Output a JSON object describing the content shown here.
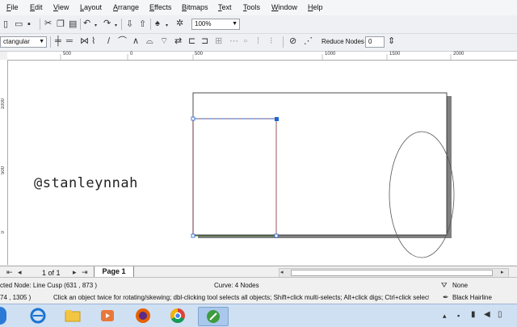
{
  "menu": [
    "File",
    "Edit",
    "View",
    "Layout",
    "Arrange",
    "Effects",
    "Bitmaps",
    "Text",
    "Tools",
    "Window",
    "Help"
  ],
  "toolbar": {
    "zoom_value": "100%"
  },
  "property_bar": {
    "shape_type": "ctangular",
    "reduce_nodes_label": "Reduce Nodes",
    "reduce_nodes_value": "0"
  },
  "ruler_h": [
    "500",
    "0",
    "500",
    "1000",
    "1500",
    "2000"
  ],
  "ruler_v": [
    "1000",
    "500",
    "0"
  ],
  "canvas": {
    "watermark": "@stanleynnah"
  },
  "pagebar": {
    "page_count": "1 of 1",
    "page_tab": "Page 1"
  },
  "status": {
    "node_info": "cted Node: Line Cusp (631  , 873  )",
    "curve_info": "Curve: 4 Nodes",
    "fill": "None",
    "coords": "74 , 1305 )",
    "hint": "Click an object twice for rotating/skewing; dbl-clicking tool selects all objects; Shift+click multi-selects; Alt+click digs; Ctrl+click selects in a gr...",
    "outline": "Black  Hairline"
  },
  "colors": {
    "selection_blue": "#1e63d6",
    "page_shadow": "#808080",
    "menu_bg": "#f5f6f7"
  }
}
